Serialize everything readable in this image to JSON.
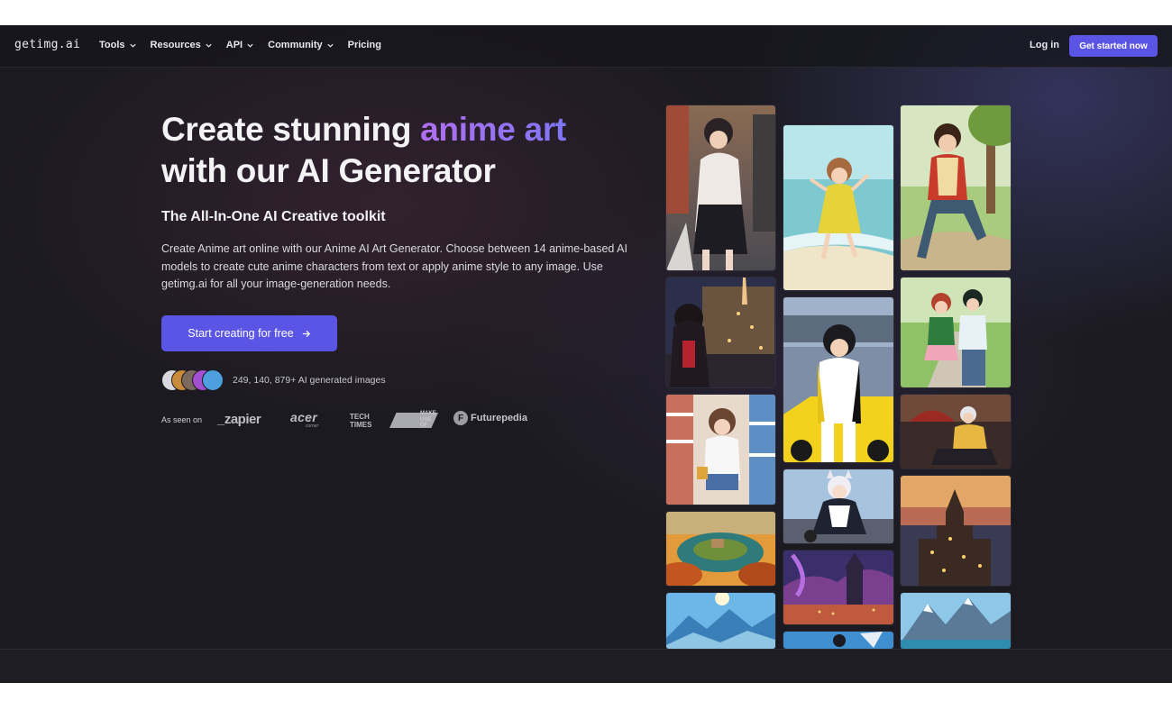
{
  "nav": {
    "logo": "getimg.ai",
    "items": [
      {
        "label": "Tools",
        "has_dropdown": true
      },
      {
        "label": "Resources",
        "has_dropdown": true
      },
      {
        "label": "API",
        "has_dropdown": true
      },
      {
        "label": "Community",
        "has_dropdown": true
      },
      {
        "label": "Pricing",
        "has_dropdown": false
      }
    ],
    "login": "Log in",
    "cta": "Get started now"
  },
  "hero": {
    "title_line1_start": "Create stunning ",
    "title_accent": "anime art",
    "title_line2": "with our AI Generator",
    "subtitle": "The All-In-One AI Creative toolkit",
    "description": "Create Anime art online with our Anime AI Art Generator. Choose between 14 anime-based AI models to create cute anime characters from text or apply anime style to any image. Use getimg.ai for all your image-generation needs.",
    "cta": "Start creating for free",
    "cta_icon": "arrow-right-icon",
    "count_text": "249, 140, 879+ AI generated images"
  },
  "press": {
    "label": "As seen on",
    "logos": {
      "zapier": "_zapier",
      "acer": "acer",
      "acer_sub": "corner",
      "techtimes": "TECH\nTIMES",
      "muo": "MAKE\nUSE\nOF",
      "futurepedia": "Futurepedia"
    }
  },
  "gallery": {
    "images": [
      "city-street-girl",
      "beach-girl-jumping",
      "park-bench-boy",
      "night-city-girl",
      "racing-girl-yellow-car",
      "park-couple",
      "store-aisle-girl",
      "umbrella-boy",
      "cat-girl-maid",
      "autumn-island",
      "castle-night",
      "gothic-tower-sunset",
      "mountain-sun",
      "sky-warrior",
      "snowy-mountains"
    ]
  },
  "colors": {
    "background": "#1b1a20",
    "accent": "#5b55e6",
    "gradient_start": "#b06ef0",
    "gradient_end": "#7f76f5"
  }
}
